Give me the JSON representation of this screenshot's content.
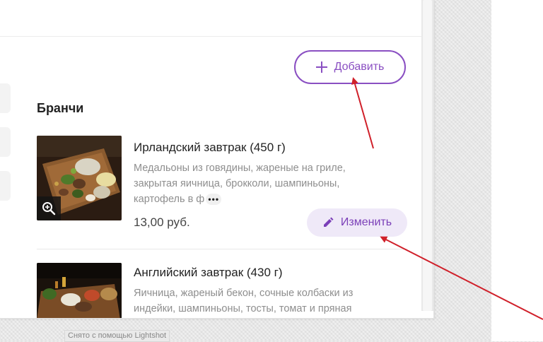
{
  "toolbar": {
    "add_label": "Добавить",
    "add_icon": "plus-icon"
  },
  "section": {
    "title": "Бранчи",
    "items": [
      {
        "title": "Ирландский завтрак (450 г)",
        "description": "Медальоны из говядины, жареные на гриле, закрытая яичница, брокколи, шампиньоны, картофель в ф",
        "more": "•••",
        "price": "13,00 руб.",
        "edit_label": "Изменить"
      },
      {
        "title": "Английский завтрак (430 г)",
        "description": "Яичница, жареный бекон, сочные колбаски из индейки, шампиньоны, тосты, томат и пряная фасоль."
      }
    ]
  },
  "watermark": "Снято с помощью Lightshot",
  "colors": {
    "accent": "#8a4fc2",
    "edit_bg": "#efe9f8",
    "arrow": "#d0202a"
  }
}
